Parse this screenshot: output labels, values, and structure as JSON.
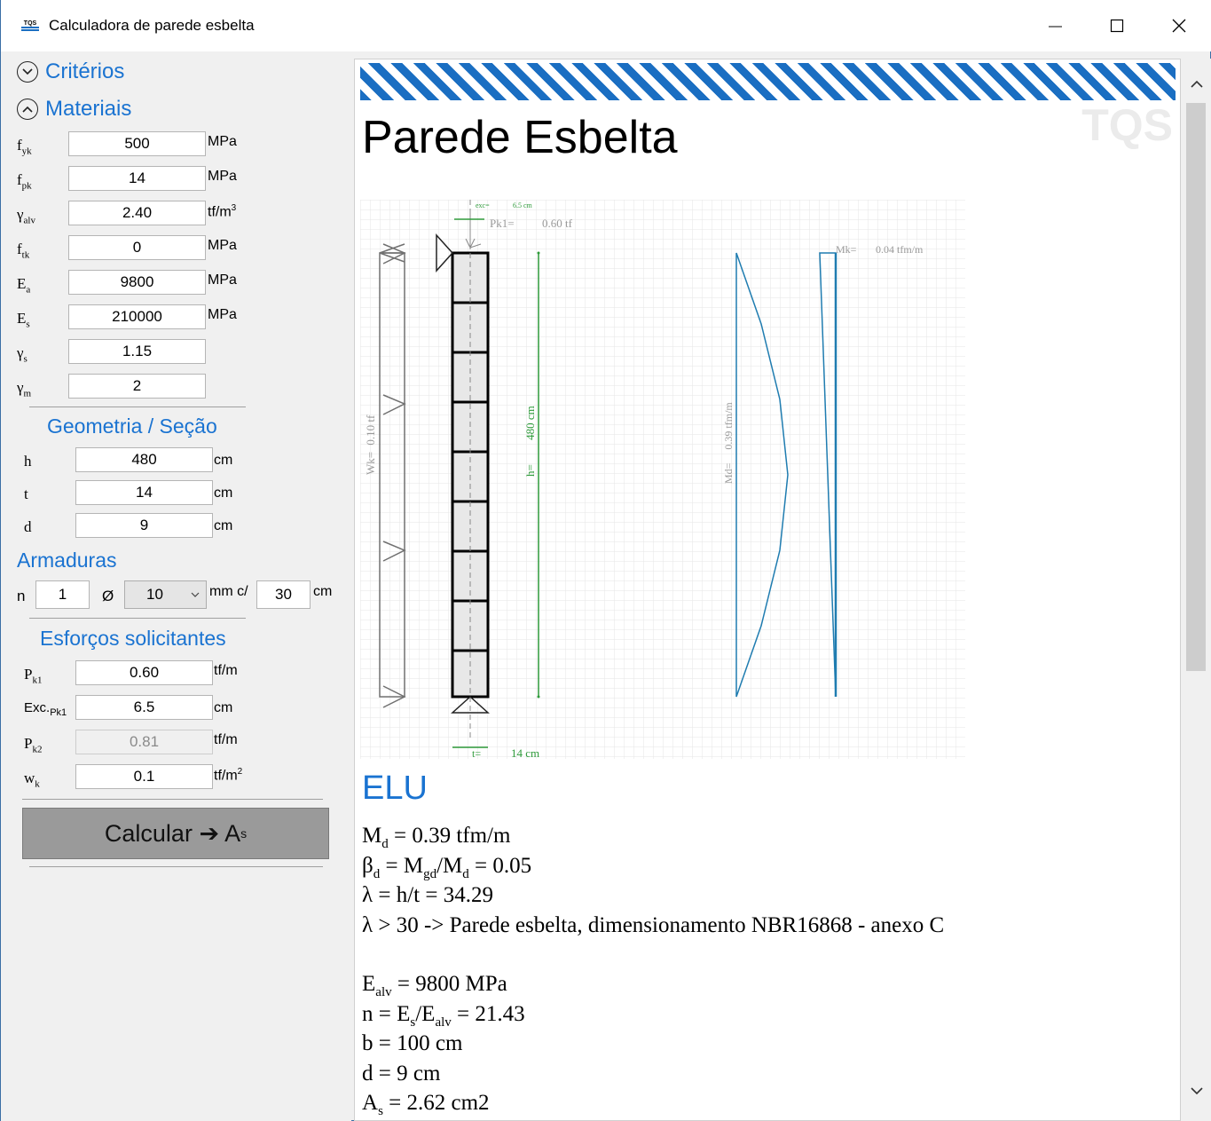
{
  "window": {
    "title": "Calculadora de parede esbelta",
    "app_icon_text": "TQS",
    "minimize": "—",
    "maximize": "☐",
    "close": "✕"
  },
  "left": {
    "criterios_label": "Critérios",
    "materiais_label": "Materiais",
    "materiais": [
      {
        "sym": "f",
        "sub": "yk",
        "value": "500",
        "unit": "MPa"
      },
      {
        "sym": "f",
        "sub": "pk",
        "value": "14",
        "unit": "MPa"
      },
      {
        "sym": "γ",
        "sub": "alv",
        "value": "2.40",
        "unit": "tf/m",
        "unit_sup": "3"
      },
      {
        "sym": "f",
        "sub": "tk",
        "value": "0",
        "unit": "MPa"
      },
      {
        "sym": "E",
        "sub": "a",
        "value": "9800",
        "unit": "MPa"
      },
      {
        "sym": "E",
        "sub": "s",
        "value": "210000",
        "unit": "MPa"
      },
      {
        "sym": "γ",
        "sub": "s",
        "value": "1.15",
        "unit": ""
      },
      {
        "sym": "γ",
        "sub": "m",
        "value": "2",
        "unit": ""
      }
    ],
    "geometria_title": "Geometria / Seção",
    "geometria": [
      {
        "sym": "h",
        "value": "480",
        "unit": "cm"
      },
      {
        "sym": "t",
        "value": "14",
        "unit": "cm"
      },
      {
        "sym": "d",
        "value": "9",
        "unit": "cm"
      }
    ],
    "armaduras_title": "Armaduras",
    "armaduras": {
      "n_label": "n",
      "n_value": "1",
      "phi_label": "Ø",
      "phi_value": "10",
      "mm_label": "mm c/",
      "spacing": "30",
      "unit": "cm"
    },
    "esforcos_title": "Esforços solicitantes",
    "esforcos": [
      {
        "sym": "P",
        "sub": "k1",
        "value": "0.60",
        "unit": "tf/m",
        "disabled": false
      },
      {
        "sym": "Exc.",
        "sub": "Pk1",
        "value": "6.5",
        "unit": "cm",
        "disabled": false
      },
      {
        "sym": "P",
        "sub": "k2",
        "value": "0.81",
        "unit": "tf/m",
        "disabled": true
      },
      {
        "sym": "w",
        "sub": "k",
        "value": "0.1",
        "unit": "tf/m",
        "unit_sup": "2",
        "disabled": false
      }
    ],
    "calc_button": "Calcular ➔ A",
    "calc_button_sub": "s"
  },
  "doc": {
    "watermark": "TQS",
    "title": "Parede Esbelta",
    "drawing_labels": {
      "exc": "exc=",
      "exc_val": "6.5 cm",
      "pk1": "Pk1=",
      "pk1_val": "0.60 tf",
      "mk": "Mk=",
      "mk_val": "0.04 tfm/m",
      "wk": "Wk=",
      "wk_val": "0.10 tf",
      "h": "h=",
      "h_val": "480 cm",
      "md": "Md=",
      "md_val": "0.39 tfm/m",
      "t": "t=",
      "t_val": "14 cm"
    },
    "elu_title": "ELU",
    "results": {
      "r1": "M",
      "r1_sub": "d",
      "r1_rest": " = 0.39 tfm/m",
      "r2": "β",
      "r2_sub": "d",
      "r2_mid": " = M",
      "r2_sub2": "gd",
      "r2_mid2": "/M",
      "r2_sub3": "d",
      "r2_rest": " = 0.05",
      "r3": "λ = h/t = 34.29",
      "r4": "λ > 30 -> Parede esbelta, dimensionamento NBR16868 - anexo C",
      "r5": "E",
      "r5_sub": "alv",
      "r5_rest": " = 9800 MPa",
      "r6": "n = E",
      "r6_sub": "s",
      "r6_mid": "/E",
      "r6_sub2": "alv",
      "r6_rest": " = 21.43",
      "r7": "b = 100 cm",
      "r8": "d = 9 cm",
      "r9": "A",
      "r9_sub": "s",
      "r9_rest": " = 2.62 cm2"
    }
  },
  "colors": {
    "accent": "#1a73d1",
    "stripe": "#1a6ec2",
    "moment": "#1f7cb0",
    "dim_green": "#2e9a3a"
  }
}
